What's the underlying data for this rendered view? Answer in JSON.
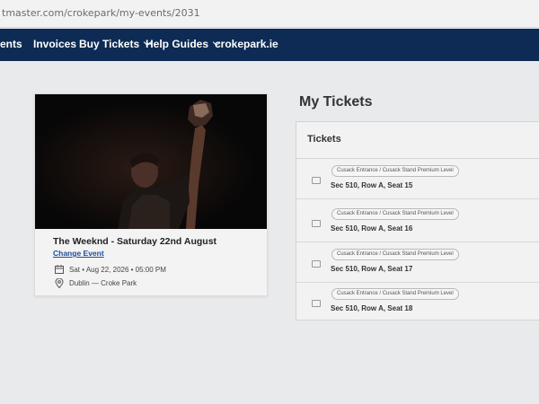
{
  "browser": {
    "url": "tmaster.com/crokepark/my-events/2031"
  },
  "nav": {
    "items": [
      {
        "label": "ents"
      },
      {
        "label": "Invoices"
      },
      {
        "label": "Buy Tickets"
      },
      {
        "label": "Help Guides"
      },
      {
        "label": "crokepark.ie"
      }
    ]
  },
  "event": {
    "title": "The Weeknd - Saturday 22nd August",
    "change_label": "Change Event",
    "datetime": "Sat • Aug 22, 2026 • 05:00 PM",
    "venue": "Dublin — Croke Park"
  },
  "tickets": {
    "heading": "My Tickets",
    "panel_title": "Tickets",
    "items": [
      {
        "badge": "Cusack Entrance / Cusack Stand Premium Level",
        "seat": "Sec 510, Row A, Seat 15"
      },
      {
        "badge": "Cusack Entrance / Cusack Stand Premium Level",
        "seat": "Sec 510, Row A, Seat 16"
      },
      {
        "badge": "Cusack Entrance / Cusack Stand Premium Level",
        "seat": "Sec 510, Row A, Seat 17"
      },
      {
        "badge": "Cusack Entrance / Cusack Stand Premium Level",
        "seat": "Sec 510, Row A, Seat 18"
      }
    ]
  },
  "colors": {
    "nav_bg": "#0d2b54",
    "link": "#1a4f9a",
    "page_bg": "#e9eaeb"
  }
}
